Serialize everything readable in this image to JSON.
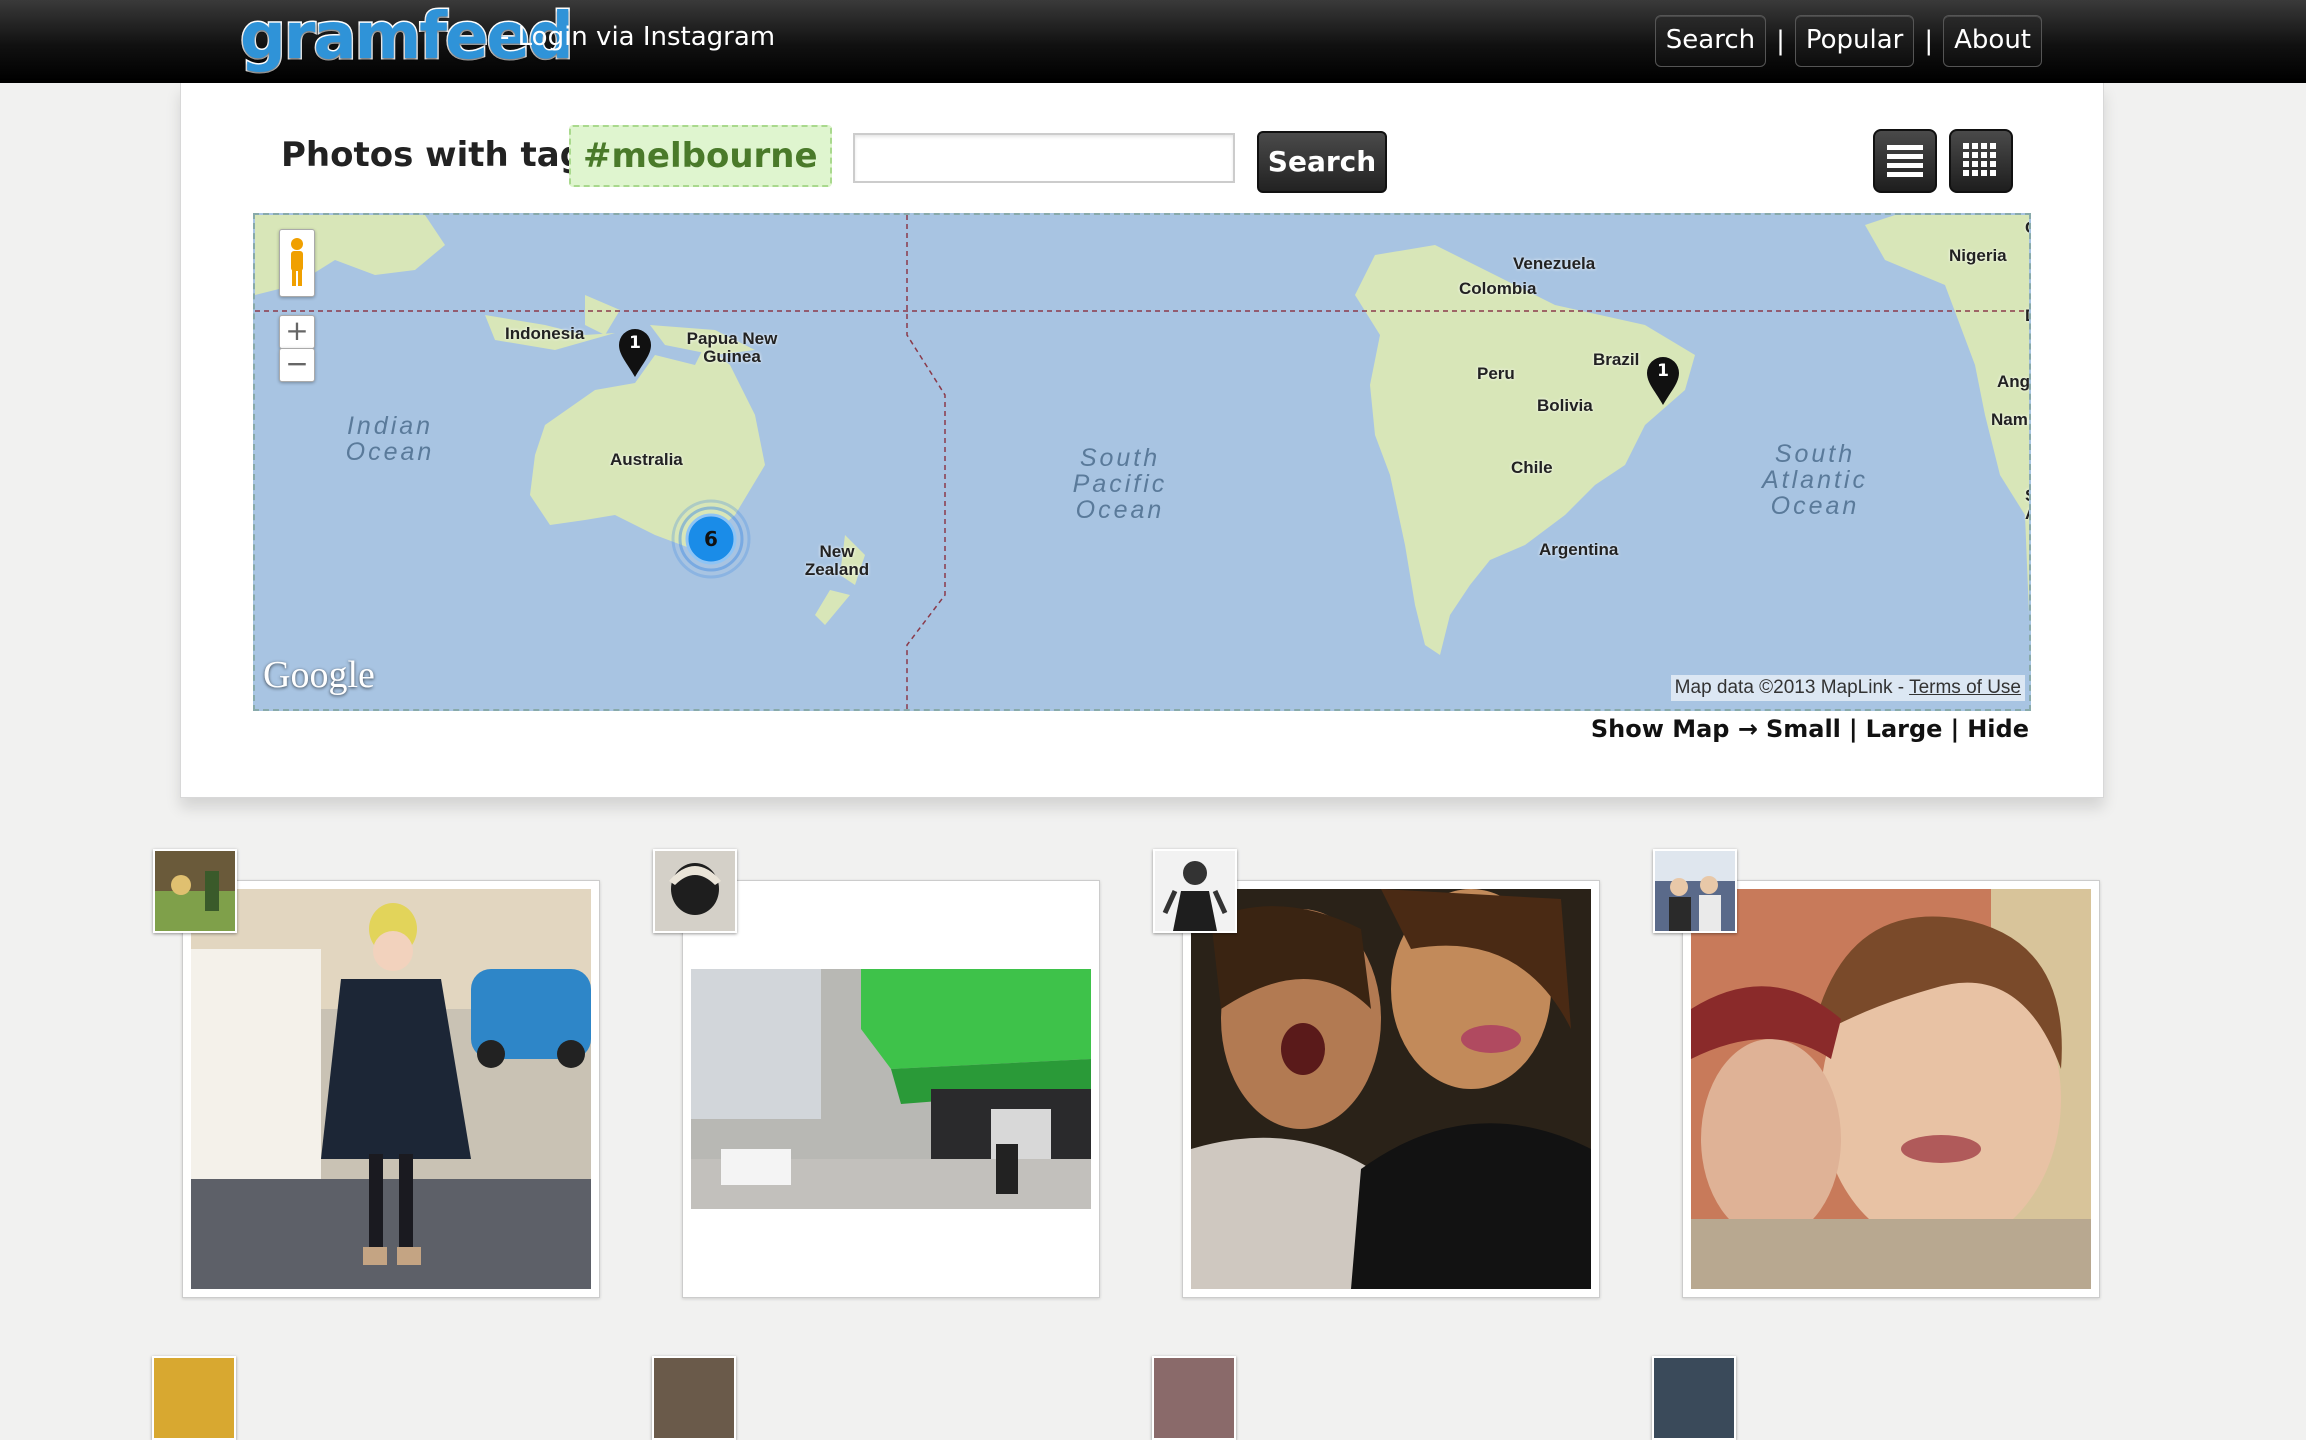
{
  "header": {
    "logo_text": "gramfeed",
    "login_text": "- Login via Instagram",
    "nav": [
      {
        "label": "Search"
      },
      {
        "label": "Popular"
      },
      {
        "label": "About"
      }
    ],
    "separator": "|"
  },
  "panel": {
    "heading": "Photos with tag",
    "tag": "#melbourne",
    "search_value": "",
    "search_button": "Search"
  },
  "map": {
    "countries": [
      "Indonesia",
      "Papua New Guinea",
      "Australia",
      "New Zealand",
      "Venezuela",
      "Colombia",
      "Nigeria",
      "Brazil",
      "Peru",
      "Bolivia",
      "Chile",
      "Argentina"
    ],
    "oceans": [
      "Indian Ocean",
      "South Pacific Ocean",
      "South Atlantic Ocean"
    ],
    "edge_labels": [
      "C",
      "D",
      "Ang",
      "Nami",
      "S",
      "A"
    ],
    "markers": [
      {
        "count": "1"
      },
      {
        "count": "1"
      }
    ],
    "cluster": {
      "count": "6"
    },
    "google": "Google",
    "attribution": "Map data ©2013 MapLink - ",
    "terms": "Terms of Use",
    "zoom_in": "+",
    "zoom_out": "−"
  },
  "map_size": {
    "prefix": "Show Map →",
    "options": [
      "Small",
      "Large",
      "Hide"
    ],
    "separator": "|"
  },
  "photos": [
    {
      "subject": "girl with beanie on street"
    },
    {
      "subject": "street with green canopy"
    },
    {
      "subject": "two girls selfie"
    },
    {
      "subject": "two boys selfie"
    }
  ],
  "colors": {
    "accent": "#2f93d8",
    "tag_bg": "#dff5cf",
    "map_water": "#a8c4e2",
    "map_land": "#d8e6b8"
  }
}
